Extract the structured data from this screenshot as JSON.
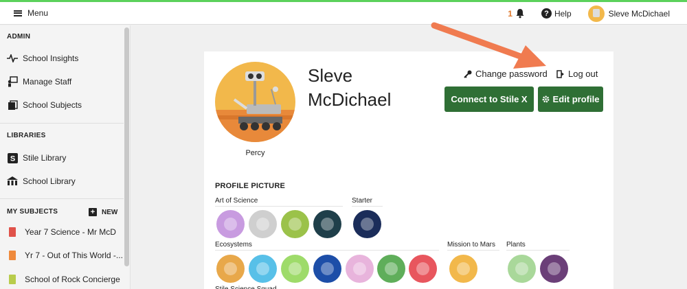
{
  "topbar": {
    "menu_label": "Menu",
    "notification_count": "1",
    "help_label": "Help",
    "user_name": "Sleve McDichael"
  },
  "sidebar": {
    "admin_heading": "ADMIN",
    "admin_items": [
      {
        "label": "School Insights",
        "icon": "pulse-icon"
      },
      {
        "label": "Manage Staff",
        "icon": "staff-icon"
      },
      {
        "label": "School Subjects",
        "icon": "books-icon"
      }
    ],
    "libraries_heading": "LIBRARIES",
    "library_items": [
      {
        "label": "Stile Library",
        "icon": "stile-logo-icon"
      },
      {
        "label": "School Library",
        "icon": "school-building-icon"
      }
    ],
    "subjects_heading": "MY SUBJECTS",
    "new_label": "NEW",
    "subject_items": [
      {
        "label": "Year 7 Science - Mr McD",
        "color": "#e0524a"
      },
      {
        "label": "Yr 7 - Out of This World -...",
        "color": "#ef8a3c"
      },
      {
        "label": "School of Rock Concierge",
        "color": "#b8cc4c"
      }
    ]
  },
  "profile": {
    "name_line1": "Sleve",
    "name_line2": "McDichael",
    "avatar_label": "Percy",
    "change_password_label": "Change password",
    "logout_label": "Log out",
    "connect_label": "Connect to Stile X",
    "edit_label": "Edit profile",
    "picture_heading": "PROFILE PICTURE",
    "groups": [
      {
        "label": "Art of Science",
        "colors": [
          "#c89be0",
          "#cfcfcf",
          "#9bc24a",
          "#1f3f4a"
        ]
      },
      {
        "label": "Starter",
        "colors": [
          "#1b2d5a"
        ]
      },
      {
        "label": "Ecosystems",
        "colors": [
          "#e8a84a",
          "#58c0e8",
          "#9edb6a",
          "#1d4ea8",
          "#e8b4dc",
          "#5fae5a",
          "#e8565e"
        ]
      },
      {
        "label": "Mission to Mars",
        "colors": [
          "#f2b84b"
        ]
      },
      {
        "label": "Plants",
        "colors": [
          "#a9d89a",
          "#6b3f78"
        ]
      },
      {
        "label": "Stile Science Squad",
        "colors": []
      }
    ]
  },
  "colors": {
    "accent_green": "#2f6f35",
    "top_stripe": "#5cd15c",
    "annotation_arrow": "#f07b50"
  }
}
